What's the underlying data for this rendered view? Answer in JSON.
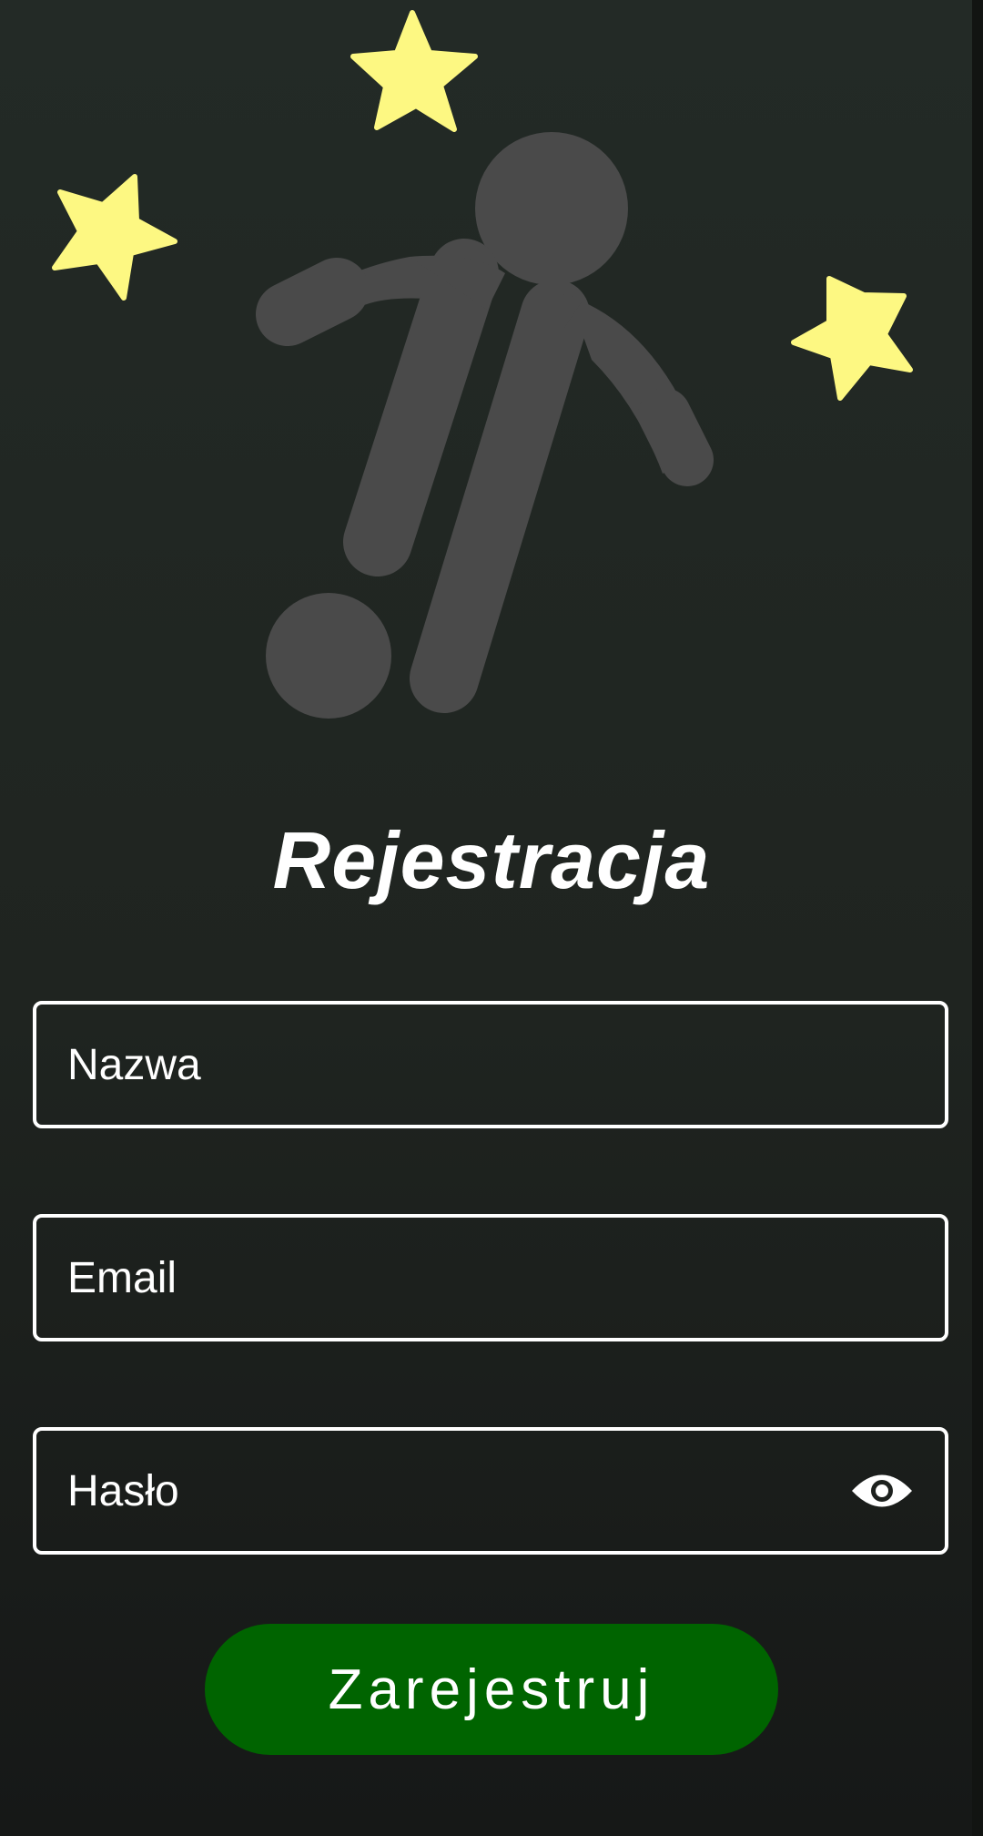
{
  "screen": {
    "title": "Rejestracja"
  },
  "form": {
    "name_placeholder": "Nazwa",
    "email_placeholder": "Email",
    "password_placeholder": "Hasło",
    "submit_label": "Zarejestruj"
  },
  "icons": {
    "hero": "football-player-icon",
    "stars": "star-icon",
    "password_toggle": "eye-icon"
  },
  "colors": {
    "background_top": "#232a26",
    "background_bottom": "#161817",
    "star": "#fdf882",
    "player": "#4a4a4a",
    "button": "#006400",
    "text": "#ffffff",
    "field_border": "#ffffff"
  }
}
